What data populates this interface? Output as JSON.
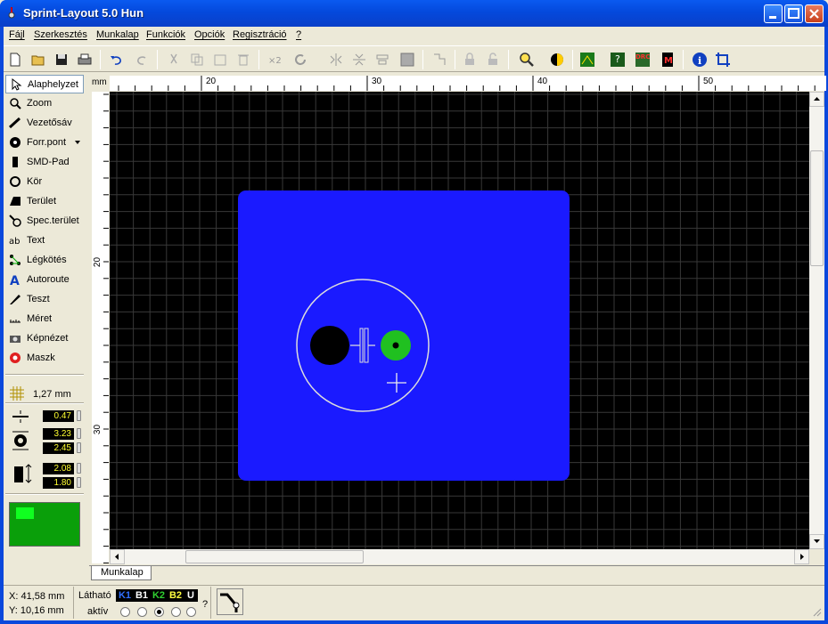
{
  "window": {
    "title": "Sprint-Layout 5.0 Hun"
  },
  "menu": [
    "Fájl",
    "Szerkesztés",
    "Munkalap",
    "Funkciók",
    "Opciók",
    "Regisztráció",
    "?"
  ],
  "tools": [
    {
      "label": "Alaphelyzet",
      "icon": "pointer-icon"
    },
    {
      "label": "Zoom",
      "icon": "zoom-icon"
    },
    {
      "label": "Vezetősáv",
      "icon": "track-icon"
    },
    {
      "label": "Forr.pont",
      "icon": "pad-icon"
    },
    {
      "label": "SMD-Pad",
      "icon": "smd-pad-icon"
    },
    {
      "label": "Kör",
      "icon": "circle-icon"
    },
    {
      "label": "Terület",
      "icon": "area-icon"
    },
    {
      "label": "Spec.terület",
      "icon": "special-area-icon"
    },
    {
      "label": "Text",
      "icon": "text-icon"
    },
    {
      "label": "Légkötés",
      "icon": "airwire-icon"
    },
    {
      "label": "Autoroute",
      "icon": "autoroute-icon"
    },
    {
      "label": "Teszt",
      "icon": "test-icon"
    },
    {
      "label": "Méret",
      "icon": "measure-icon"
    },
    {
      "label": "Képnézet",
      "icon": "photoview-icon"
    },
    {
      "label": "Maszk",
      "icon": "mask-icon"
    }
  ],
  "grid": {
    "value": "1,27 mm"
  },
  "track_width": "0.47",
  "pad_outer": "3.23",
  "pad_inner": "2.45",
  "smd_w": "2.08",
  "smd_h": "1.80",
  "ruler": {
    "unit": "mm",
    "top_labels": [
      "20",
      "30",
      "40",
      "50"
    ],
    "left_labels": [
      "20",
      "30"
    ]
  },
  "tab": "Munkalap",
  "status": {
    "x": "X:  41,58 mm",
    "y": "Y:  10,16 mm",
    "visible_label": "Látható",
    "active_label": "aktív",
    "layers": [
      "K1",
      "B1",
      "K2",
      "B2",
      "U"
    ],
    "layer_colors": [
      "#3070ff",
      "#ffffff",
      "#30d030",
      "#ffff40",
      "#ffffff"
    ],
    "active_layer": "K2",
    "help": "?"
  },
  "colors": {
    "board": "#1a1aff",
    "pad_green": "#20c020",
    "grid": "#333333"
  }
}
